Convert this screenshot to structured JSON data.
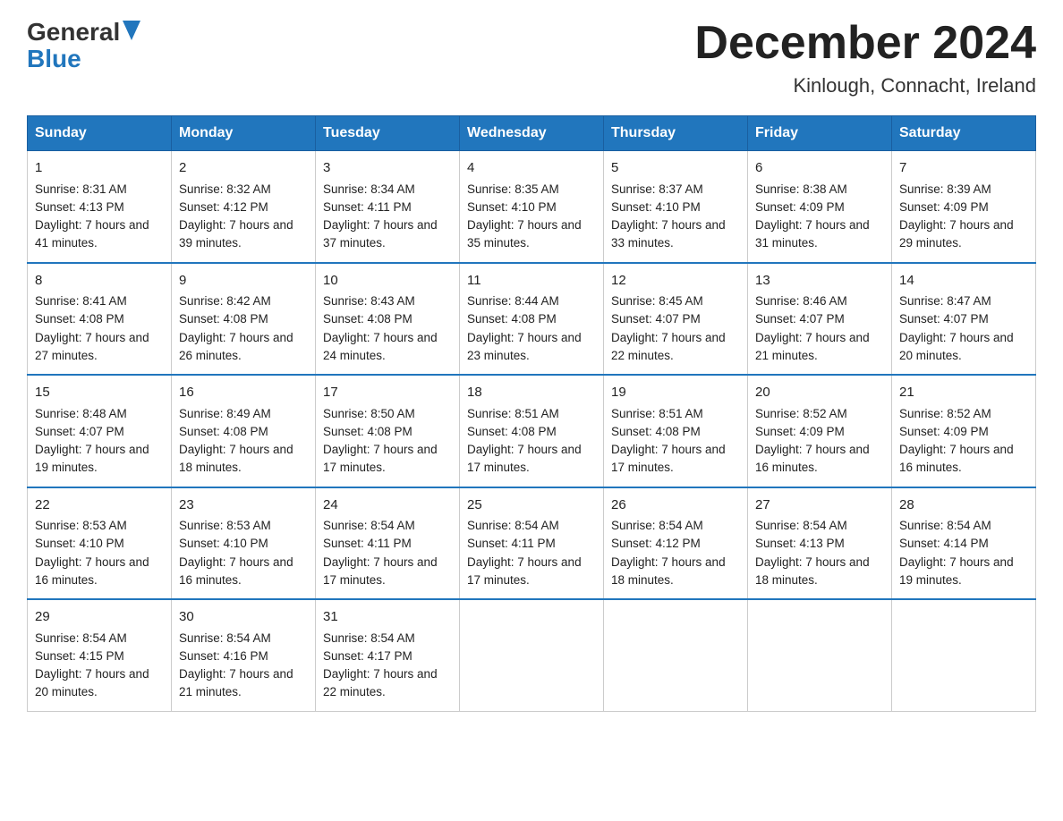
{
  "header": {
    "logo_general": "General",
    "logo_blue": "Blue",
    "month_title": "December 2024",
    "location": "Kinlough, Connacht, Ireland"
  },
  "days_of_week": [
    "Sunday",
    "Monday",
    "Tuesday",
    "Wednesday",
    "Thursday",
    "Friday",
    "Saturday"
  ],
  "weeks": [
    [
      {
        "day": "1",
        "sunrise": "8:31 AM",
        "sunset": "4:13 PM",
        "daylight": "7 hours and 41 minutes."
      },
      {
        "day": "2",
        "sunrise": "8:32 AM",
        "sunset": "4:12 PM",
        "daylight": "7 hours and 39 minutes."
      },
      {
        "day": "3",
        "sunrise": "8:34 AM",
        "sunset": "4:11 PM",
        "daylight": "7 hours and 37 minutes."
      },
      {
        "day": "4",
        "sunrise": "8:35 AM",
        "sunset": "4:10 PM",
        "daylight": "7 hours and 35 minutes."
      },
      {
        "day": "5",
        "sunrise": "8:37 AM",
        "sunset": "4:10 PM",
        "daylight": "7 hours and 33 minutes."
      },
      {
        "day": "6",
        "sunrise": "8:38 AM",
        "sunset": "4:09 PM",
        "daylight": "7 hours and 31 minutes."
      },
      {
        "day": "7",
        "sunrise": "8:39 AM",
        "sunset": "4:09 PM",
        "daylight": "7 hours and 29 minutes."
      }
    ],
    [
      {
        "day": "8",
        "sunrise": "8:41 AM",
        "sunset": "4:08 PM",
        "daylight": "7 hours and 27 minutes."
      },
      {
        "day": "9",
        "sunrise": "8:42 AM",
        "sunset": "4:08 PM",
        "daylight": "7 hours and 26 minutes."
      },
      {
        "day": "10",
        "sunrise": "8:43 AM",
        "sunset": "4:08 PM",
        "daylight": "7 hours and 24 minutes."
      },
      {
        "day": "11",
        "sunrise": "8:44 AM",
        "sunset": "4:08 PM",
        "daylight": "7 hours and 23 minutes."
      },
      {
        "day": "12",
        "sunrise": "8:45 AM",
        "sunset": "4:07 PM",
        "daylight": "7 hours and 22 minutes."
      },
      {
        "day": "13",
        "sunrise": "8:46 AM",
        "sunset": "4:07 PM",
        "daylight": "7 hours and 21 minutes."
      },
      {
        "day": "14",
        "sunrise": "8:47 AM",
        "sunset": "4:07 PM",
        "daylight": "7 hours and 20 minutes."
      }
    ],
    [
      {
        "day": "15",
        "sunrise": "8:48 AM",
        "sunset": "4:07 PM",
        "daylight": "7 hours and 19 minutes."
      },
      {
        "day": "16",
        "sunrise": "8:49 AM",
        "sunset": "4:08 PM",
        "daylight": "7 hours and 18 minutes."
      },
      {
        "day": "17",
        "sunrise": "8:50 AM",
        "sunset": "4:08 PM",
        "daylight": "7 hours and 17 minutes."
      },
      {
        "day": "18",
        "sunrise": "8:51 AM",
        "sunset": "4:08 PM",
        "daylight": "7 hours and 17 minutes."
      },
      {
        "day": "19",
        "sunrise": "8:51 AM",
        "sunset": "4:08 PM",
        "daylight": "7 hours and 17 minutes."
      },
      {
        "day": "20",
        "sunrise": "8:52 AM",
        "sunset": "4:09 PM",
        "daylight": "7 hours and 16 minutes."
      },
      {
        "day": "21",
        "sunrise": "8:52 AM",
        "sunset": "4:09 PM",
        "daylight": "7 hours and 16 minutes."
      }
    ],
    [
      {
        "day": "22",
        "sunrise": "8:53 AM",
        "sunset": "4:10 PM",
        "daylight": "7 hours and 16 minutes."
      },
      {
        "day": "23",
        "sunrise": "8:53 AM",
        "sunset": "4:10 PM",
        "daylight": "7 hours and 16 minutes."
      },
      {
        "day": "24",
        "sunrise": "8:54 AM",
        "sunset": "4:11 PM",
        "daylight": "7 hours and 17 minutes."
      },
      {
        "day": "25",
        "sunrise": "8:54 AM",
        "sunset": "4:11 PM",
        "daylight": "7 hours and 17 minutes."
      },
      {
        "day": "26",
        "sunrise": "8:54 AM",
        "sunset": "4:12 PM",
        "daylight": "7 hours and 18 minutes."
      },
      {
        "day": "27",
        "sunrise": "8:54 AM",
        "sunset": "4:13 PM",
        "daylight": "7 hours and 18 minutes."
      },
      {
        "day": "28",
        "sunrise": "8:54 AM",
        "sunset": "4:14 PM",
        "daylight": "7 hours and 19 minutes."
      }
    ],
    [
      {
        "day": "29",
        "sunrise": "8:54 AM",
        "sunset": "4:15 PM",
        "daylight": "7 hours and 20 minutes."
      },
      {
        "day": "30",
        "sunrise": "8:54 AM",
        "sunset": "4:16 PM",
        "daylight": "7 hours and 21 minutes."
      },
      {
        "day": "31",
        "sunrise": "8:54 AM",
        "sunset": "4:17 PM",
        "daylight": "7 hours and 22 minutes."
      },
      null,
      null,
      null,
      null
    ]
  ],
  "labels": {
    "sunrise": "Sunrise:",
    "sunset": "Sunset:",
    "daylight": "Daylight:"
  }
}
